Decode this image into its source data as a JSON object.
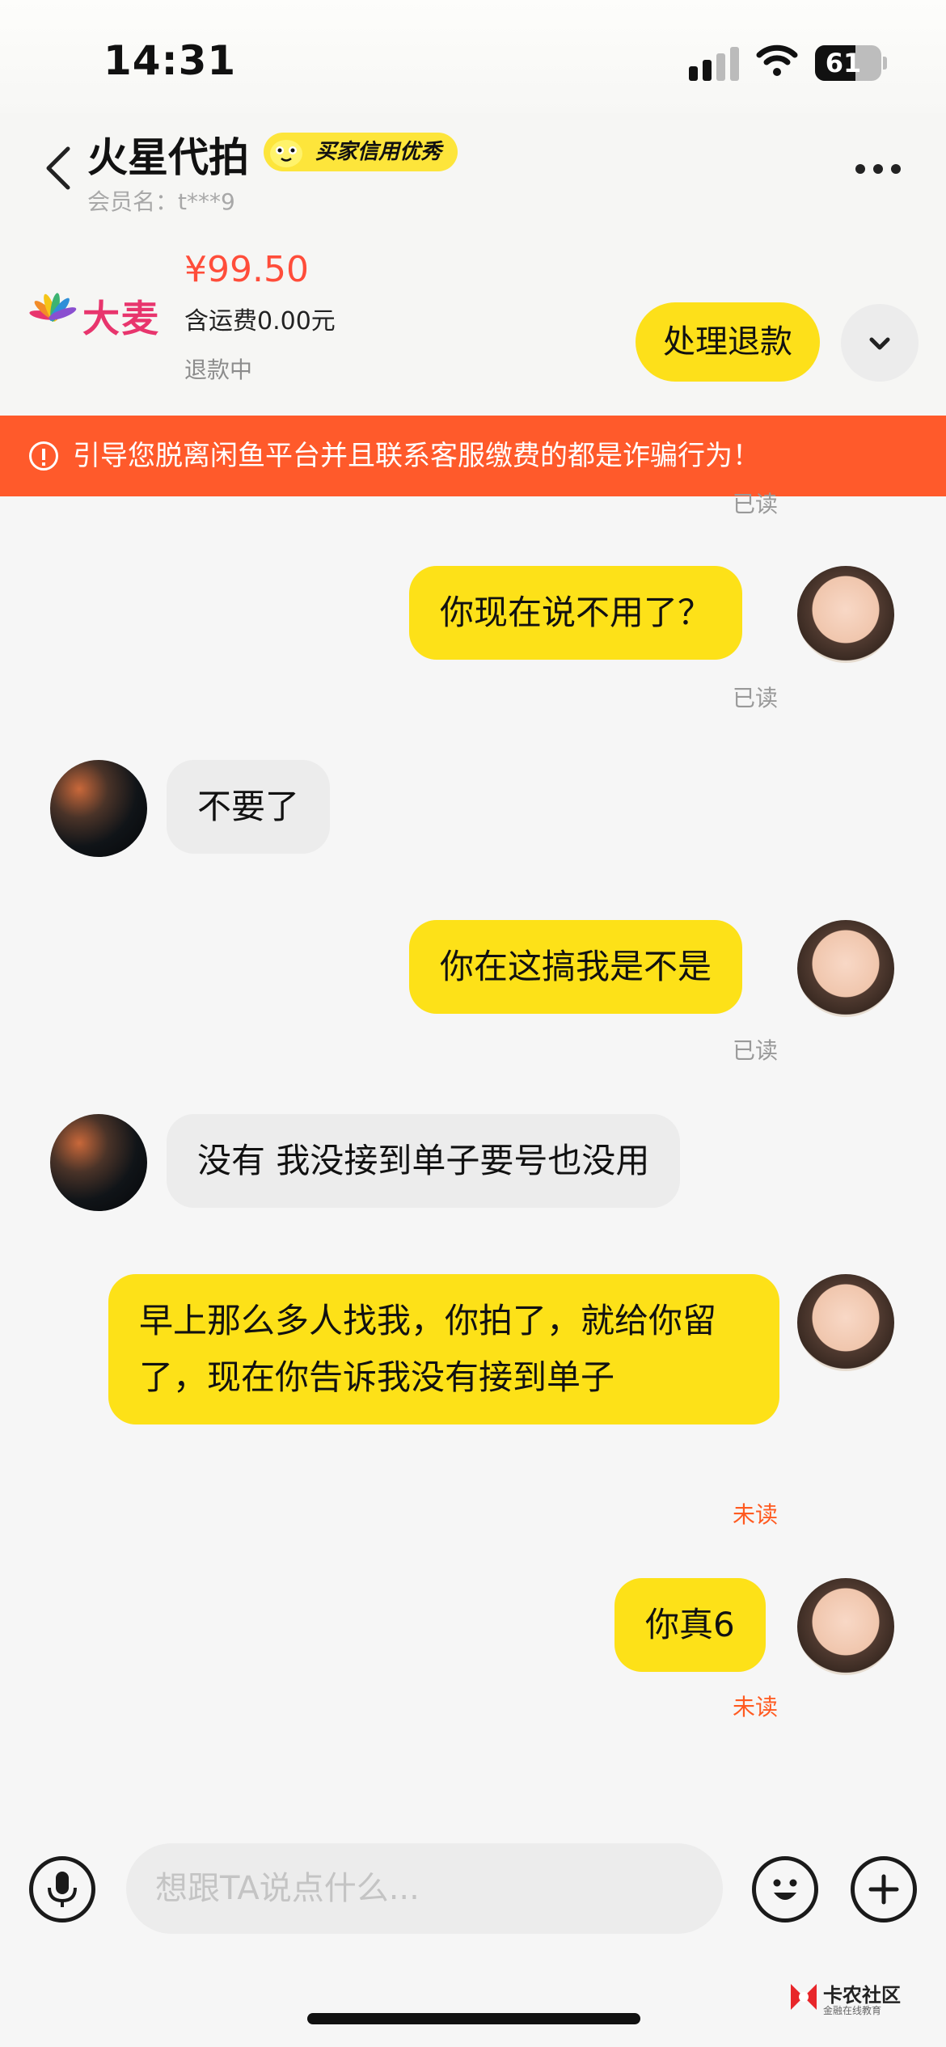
{
  "status_bar": {
    "time": "14:31",
    "battery": "61",
    "battery_level": 0.61
  },
  "header": {
    "seller_name": "火星代拍",
    "credit_badge": "买家信用优秀",
    "member_label": "会员名：t***9",
    "more_icon": "more-icon"
  },
  "product": {
    "logo_text": "大麦",
    "price": "¥99.50",
    "shipping": "含运费0.00元",
    "status": "退款中",
    "refund_button": "处理退款"
  },
  "warning": "引导您脱离闲鱼平台并且联系客服缴费的都是诈骗行为！",
  "messages": [
    {
      "side": "status",
      "status": "已读"
    },
    {
      "side": "me",
      "text": "你现在说不用了？",
      "status": "已读"
    },
    {
      "side": "them",
      "text": "不要了"
    },
    {
      "side": "me",
      "text": "你在这搞我是不是",
      "status": "已读"
    },
    {
      "side": "them",
      "text": "没有 我没接到单子要号也没用"
    },
    {
      "side": "me",
      "text": "早上那么多人找我，你拍了，就给你留了，现在你告诉我没有接到单子",
      "status": "未读"
    },
    {
      "side": "me",
      "text": "你真6",
      "status": "未读"
    }
  ],
  "input": {
    "placeholder": "想跟TA说点什么..."
  },
  "watermark": {
    "title": "卡农社区",
    "subtitle": "金融在线教育"
  },
  "colors": {
    "accent": "#fde118",
    "warning": "#ff5a2b",
    "price": "#ff4d3a",
    "unread": "#ff5a20"
  }
}
